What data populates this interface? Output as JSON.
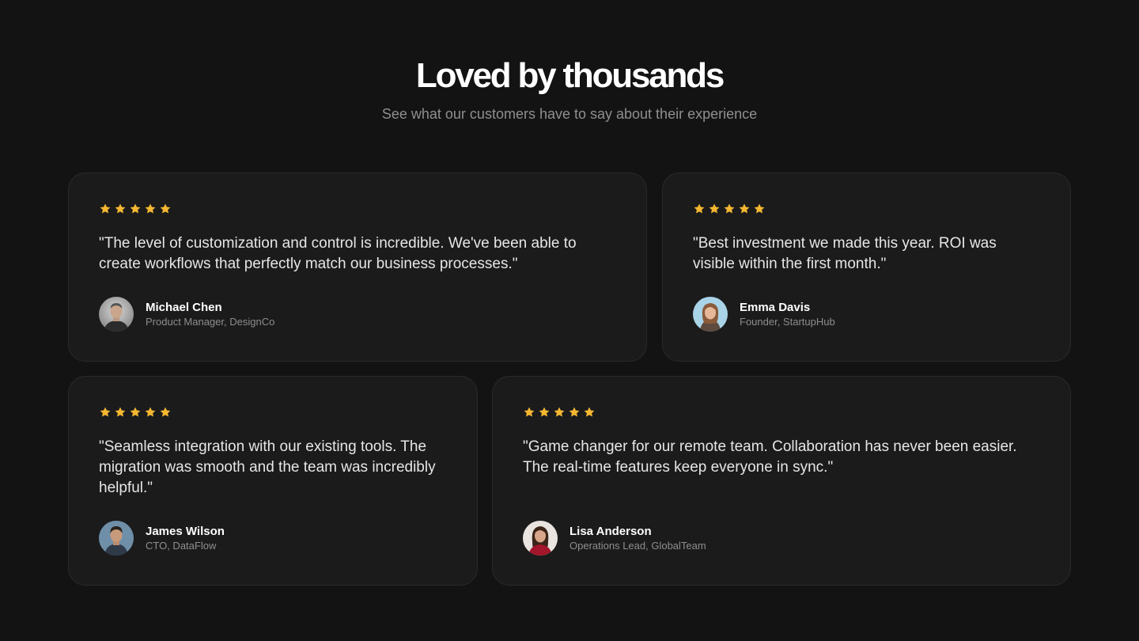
{
  "header": {
    "title": "Loved by thousands",
    "subtitle": "See what our customers have to say about their experience"
  },
  "colors": {
    "background": "#131313",
    "card": "#1b1b1c",
    "star": "#f5b731"
  },
  "testimonials": [
    {
      "rating": 5,
      "quote": "\"The level of customization and control is incredible. We've been able to create workflows that perfectly match our business processes.\"",
      "name": "Michael Chen",
      "role": "Product Manager, DesignCo",
      "avatar_icon": "avatar-michael-chen"
    },
    {
      "rating": 5,
      "quote": "\"Best investment we made this year. ROI was visible within the first month.\"",
      "name": "Emma Davis",
      "role": "Founder, StartupHub",
      "avatar_icon": "avatar-emma-davis"
    },
    {
      "rating": 5,
      "quote": "\"Seamless integration with our existing tools. The migration was smooth and the team was incredibly helpful.\"",
      "name": "James Wilson",
      "role": "CTO, DataFlow",
      "avatar_icon": "avatar-james-wilson"
    },
    {
      "rating": 5,
      "quote": "\"Game changer for our remote team. Collaboration has never been easier. The real-time features keep everyone in sync.\"",
      "name": "Lisa Anderson",
      "role": "Operations Lead, GlobalTeam",
      "avatar_icon": "avatar-lisa-anderson"
    }
  ]
}
